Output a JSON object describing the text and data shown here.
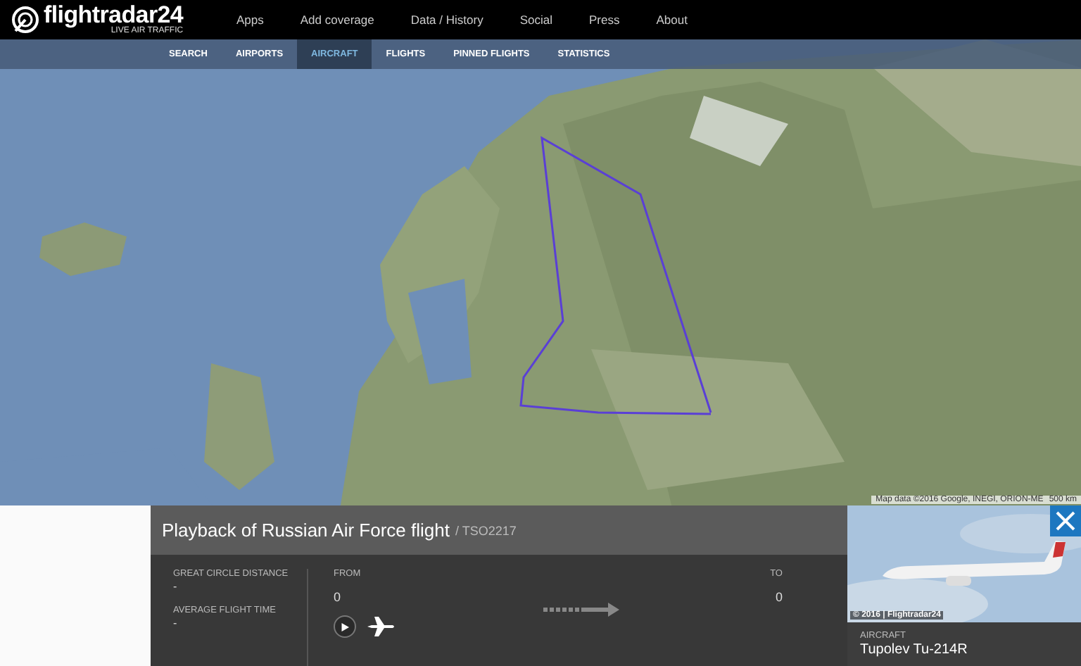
{
  "header": {
    "logo": "flightradar24",
    "tagline": "LIVE AIR TRAFFIC",
    "menu": [
      "Apps",
      "Add coverage",
      "Data / History",
      "Social",
      "Press",
      "About"
    ]
  },
  "subnav": [
    {
      "label": "SEARCH",
      "selected": false
    },
    {
      "label": "AIRPORTS",
      "selected": false
    },
    {
      "label": "AIRCRAFT",
      "selected": true
    },
    {
      "label": "FLIGHTS",
      "selected": false
    },
    {
      "label": "PINNED FLIGHTS",
      "selected": false
    },
    {
      "label": "STATISTICS",
      "selected": false
    }
  ],
  "map": {
    "attribution": "Map data ©2016 Google, INEGI, ORION-ME",
    "scale": "500 km"
  },
  "flight_panel": {
    "title": "Playback of Russian Air Force flight",
    "callsign": "/ TSO2217",
    "stats": [
      {
        "label": "GREAT CIRCLE DISTANCE",
        "value": "-"
      },
      {
        "label": "AVERAGE FLIGHT TIME",
        "value": "-"
      }
    ],
    "from": {
      "label": "FROM",
      "value": "0"
    },
    "to": {
      "label": "TO",
      "value": "0"
    }
  },
  "aircraft": {
    "photo_credit": "© 2016 | Flightradar24",
    "label": "AIRCRAFT",
    "model": "Tupolev Tu-214R"
  }
}
